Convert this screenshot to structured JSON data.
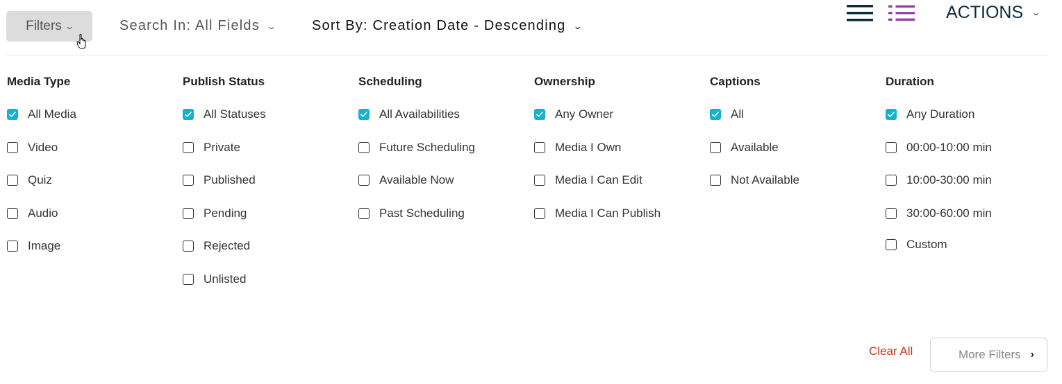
{
  "toolbar": {
    "filters_label": "Filters",
    "search_in_label": "Search In: All Fields",
    "sort_by_label": "Sort By: Creation Date - Descending",
    "actions_label": "ACTIONS",
    "icons": {
      "list_view": "hamburger-list-icon",
      "detailed_view": "bullet-list-icon"
    }
  },
  "colors": {
    "checkbox_checked": "#12b2d2",
    "clear_all": "#c0391b",
    "actions": "#0d2c3c",
    "detailed_view_icon": "#8e44a0"
  },
  "filter_groups": [
    {
      "title": "Media Type",
      "options": [
        {
          "label": "All Media",
          "checked": true
        },
        {
          "label": "Video",
          "checked": false
        },
        {
          "label": "Quiz",
          "checked": false
        },
        {
          "label": "Audio",
          "checked": false
        },
        {
          "label": "Image",
          "checked": false
        }
      ]
    },
    {
      "title": "Publish Status",
      "options": [
        {
          "label": "All Statuses",
          "checked": true
        },
        {
          "label": "Private",
          "checked": false
        },
        {
          "label": "Published",
          "checked": false
        },
        {
          "label": "Pending",
          "checked": false
        },
        {
          "label": "Rejected",
          "checked": false
        },
        {
          "label": "Unlisted",
          "checked": false
        }
      ]
    },
    {
      "title": "Scheduling",
      "options": [
        {
          "label": "All Availabilities",
          "checked": true
        },
        {
          "label": "Future Scheduling",
          "checked": false
        },
        {
          "label": "Available Now",
          "checked": false
        },
        {
          "label": "Past Scheduling",
          "checked": false
        }
      ]
    },
    {
      "title": "Ownership",
      "options": [
        {
          "label": "Any Owner",
          "checked": true
        },
        {
          "label": "Media I Own",
          "checked": false
        },
        {
          "label": "Media I Can Edit",
          "checked": false
        },
        {
          "label": "Media I Can Publish",
          "checked": false
        }
      ]
    },
    {
      "title": "Captions",
      "options": [
        {
          "label": "All",
          "checked": true
        },
        {
          "label": "Available",
          "checked": false
        },
        {
          "label": "Not Available",
          "checked": false
        }
      ]
    },
    {
      "title": "Duration",
      "options": [
        {
          "label": "Any Duration",
          "checked": true
        },
        {
          "label": "00:00-10:00 min",
          "checked": false
        },
        {
          "label": "10:00-30:00 min",
          "checked": false
        },
        {
          "label": "30:00-60:00 min",
          "checked": false
        },
        {
          "label": "Custom",
          "checked": false
        }
      ]
    }
  ],
  "footer": {
    "clear_all_label": "Clear All",
    "more_filters_label": "More Filters"
  }
}
